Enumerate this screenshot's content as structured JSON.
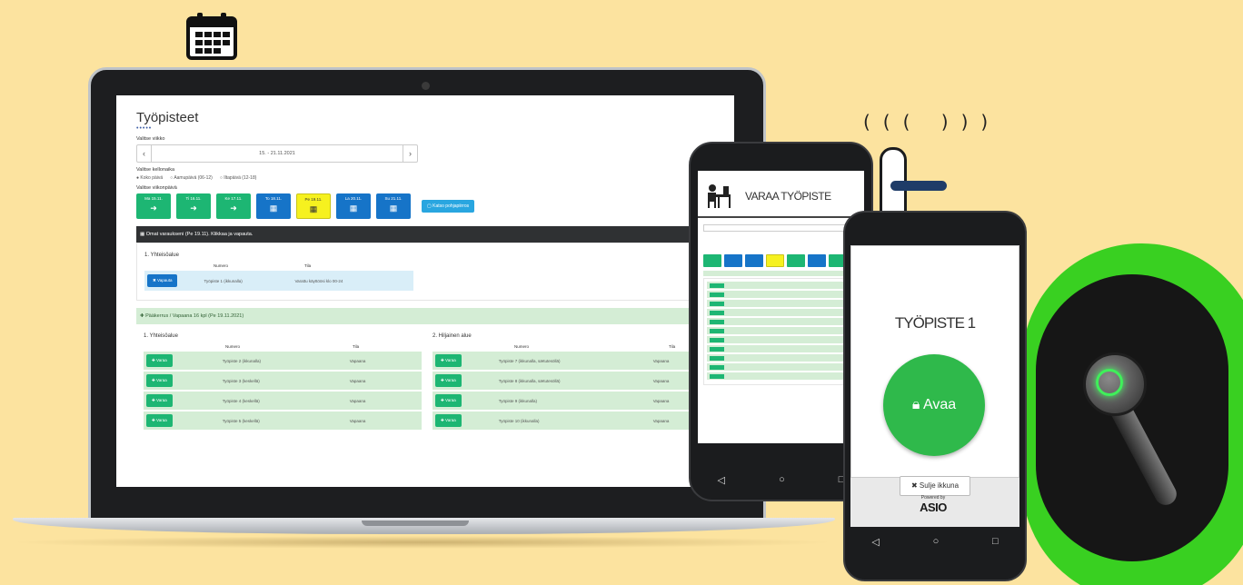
{
  "laptop": {
    "title": "Työpisteet",
    "dots": "•••••",
    "week_label": "Valitse viikko",
    "week_value": "15. - 21.11.2021",
    "time_label": "Valitse kellonaika",
    "radio_options": [
      "Koko päivä",
      "Aamupäivä (06-12)",
      "Iltapäivä (12-18)"
    ],
    "day_label": "Valitse viikonpäivä",
    "days": [
      {
        "label": "Ma 15.11.",
        "icon": "arrow-right",
        "color": "green"
      },
      {
        "label": "Ti 16.11.",
        "icon": "arrow-right",
        "color": "green"
      },
      {
        "label": "Ke 17.11.",
        "icon": "arrow-right",
        "color": "green"
      },
      {
        "label": "To 18.11.",
        "icon": "calendar",
        "color": "blue"
      },
      {
        "label": "Pe 19.11.",
        "icon": "calendar",
        "color": "yellow"
      },
      {
        "label": "La 20.11.",
        "icon": "calendar",
        "color": "blue"
      },
      {
        "label": "Su 21.11.",
        "icon": "calendar",
        "color": "blue"
      }
    ],
    "floorplan_button": "Katso pohjapiirros",
    "own_bar": "Omat varaukseni (Pe 19.11). Klikkaa ja vapauta.",
    "own_section": "1. Yhteisöalue",
    "col_numero": "Numero",
    "col_tila": "Tila",
    "own_row": {
      "button": "Vapauta",
      "numero": "Työpiste 1 (ikkunalla)",
      "tila": "Varattu käyttöösi klo 00-24"
    },
    "free_bar": "Pääkerrus / Vapaana 16 kpl (Pe 19.11.2021)",
    "areas": [
      {
        "name": "1. Yhteisöalue",
        "rows": [
          {
            "numero": "Työpiste 2 (ikkunalla)",
            "tila": "Vapaana"
          },
          {
            "numero": "Työpiste 3 (keskellä)",
            "tila": "Vapaana"
          },
          {
            "numero": "Työpiste 4 (keskellä)",
            "tila": "Vapaana"
          },
          {
            "numero": "Työpiste 5 (keskellä)",
            "tila": "Vapaana"
          }
        ]
      },
      {
        "name": "2. Hiljainen alue",
        "rows": [
          {
            "numero": "Työpiste 7 (ikkunalla, sætutesöllä)",
            "tila": "Vapaana"
          },
          {
            "numero": "Työpiste 8 (ikkunalla, sætutesöllä)",
            "tila": "Vapaana"
          },
          {
            "numero": "Työpiste 9 (ikkunalla)",
            "tila": "Vapaana"
          },
          {
            "numero": "Työpiste 10 (ikkunalla)",
            "tila": "Vapaana"
          }
        ]
      }
    ],
    "reserve_button": "Varaa"
  },
  "phone1": {
    "title": "VARAA TYÖPISTE",
    "nav": [
      "◁",
      "○",
      "□"
    ]
  },
  "phone2": {
    "title": "TYÖPISTE 1",
    "open_button": "Avaa",
    "close_button": "Sulje ikkuna",
    "powered_by": "Powered by",
    "brand": "ASIO",
    "nav": [
      "◁",
      "○",
      "□"
    ]
  },
  "colors": {
    "background": "#fce39f",
    "green": "#1db673",
    "blue": "#1674c8",
    "yellow": "#f6f11f",
    "open_green": "#2fb94b",
    "ring_green": "#39d021"
  }
}
